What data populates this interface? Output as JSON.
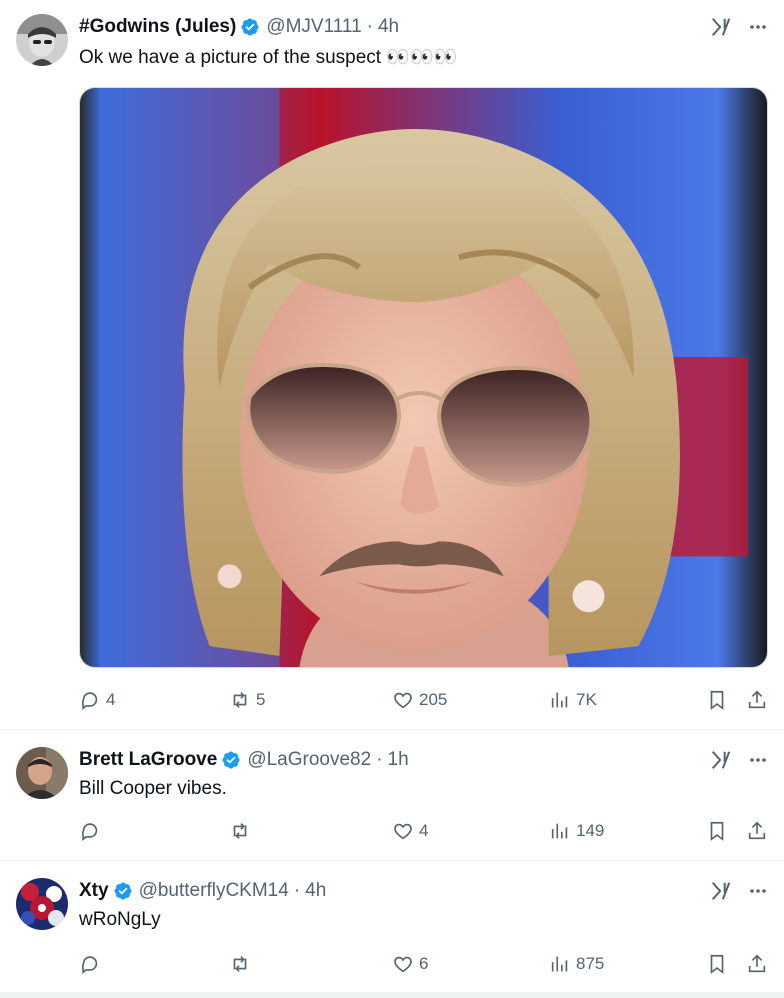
{
  "colors": {
    "verified": "#1d9bf0",
    "muted": "#536471",
    "text": "#0f1419"
  },
  "posts": [
    {
      "name": "#Godwins (Jules)",
      "handle": "@MJV1111",
      "time": "4h",
      "text": "Ok we have a picture of the suspect 👀👀👀",
      "replies": "4",
      "reposts": "5",
      "likes": "205",
      "views": "7K",
      "has_media": true
    },
    {
      "name": "Brett LaGroove",
      "handle": "@LaGroove82",
      "time": "1h",
      "text": "Bill Cooper vibes.",
      "replies": "",
      "reposts": "",
      "likes": "4",
      "views": "149"
    },
    {
      "name": "Xty",
      "handle": "@butterflyCKM14",
      "time": "4h",
      "text": "wRoNgLy",
      "replies": "",
      "reposts": "",
      "likes": "6",
      "views": "875"
    }
  ],
  "icons": {
    "reply": "reply-icon",
    "repost": "repost-icon",
    "like": "heart-icon",
    "views": "views-icon",
    "bookmark": "bookmark-icon",
    "share": "share-icon",
    "grok": "grok-icon",
    "more": "more-icon",
    "verified": "verified-badge-icon"
  }
}
